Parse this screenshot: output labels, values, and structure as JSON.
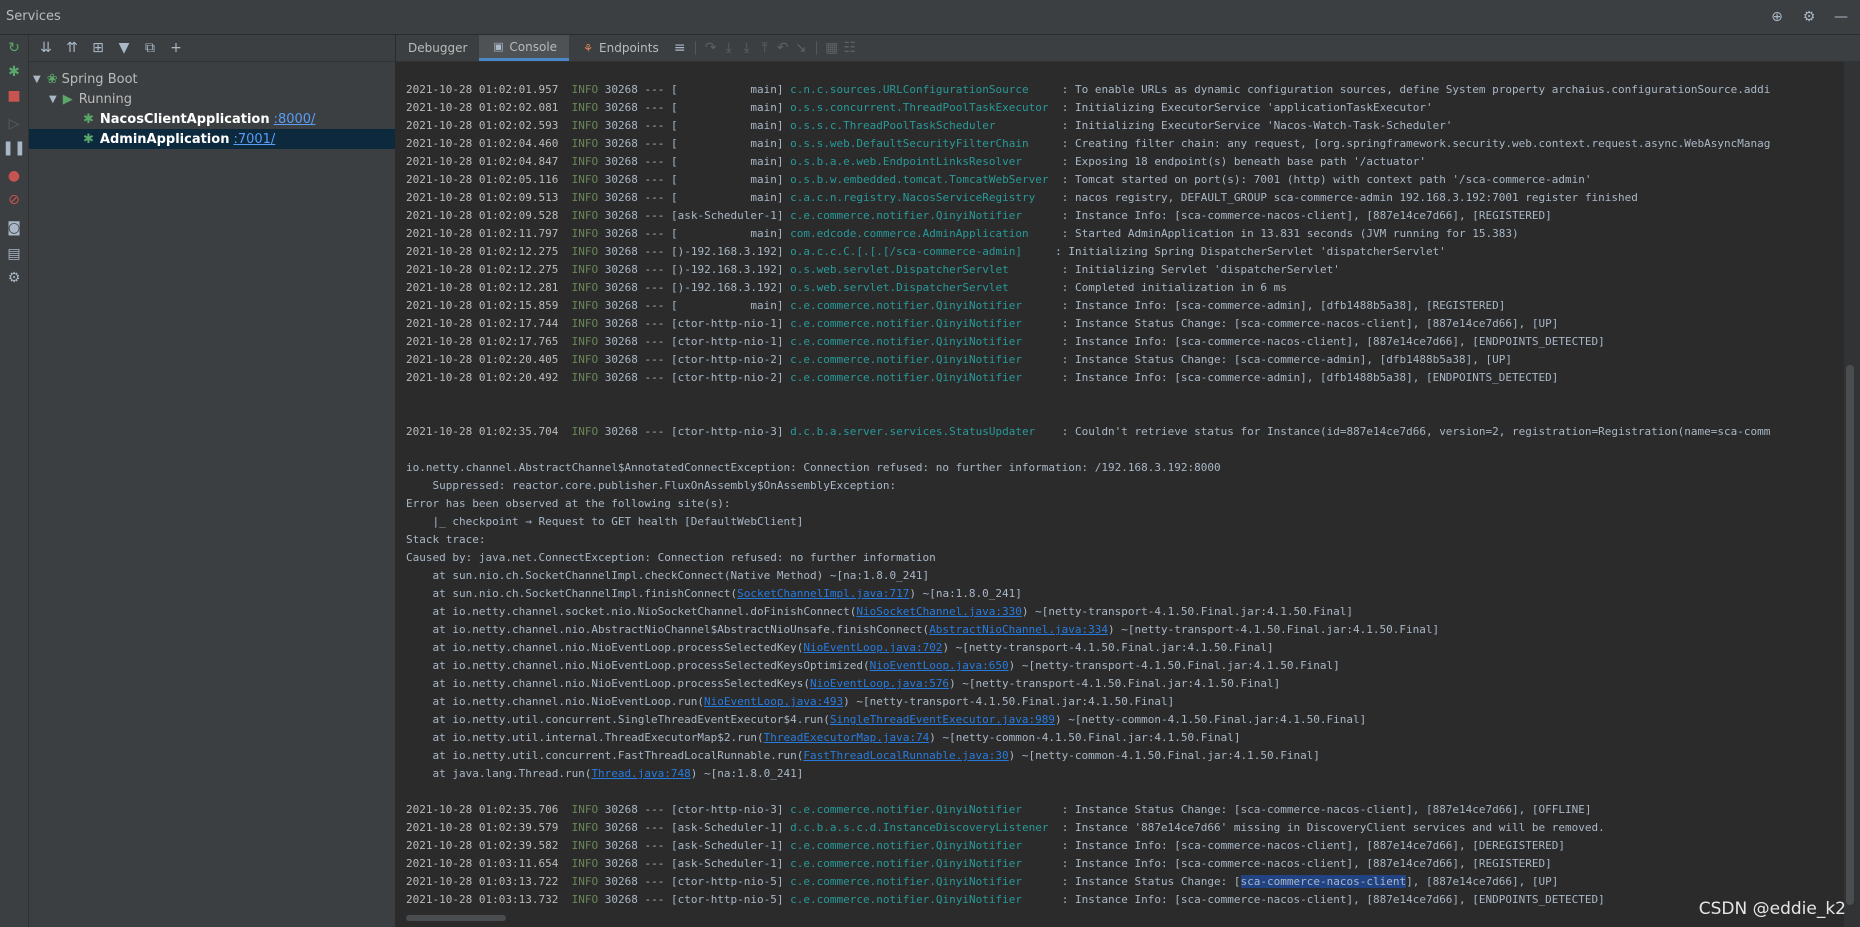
{
  "window": {
    "title": "Services"
  },
  "tree": {
    "root_label": "Spring Boot",
    "running_label": "Running",
    "apps": [
      {
        "name": "NacosClientApplication",
        "port": ":8000/"
      },
      {
        "name": "AdminApplication",
        "port": ":7001/"
      }
    ]
  },
  "tabs": {
    "debugger": "Debugger",
    "console": "Console",
    "endpoints": "Endpoints"
  },
  "watermark": "CSDN @eddie_k2",
  "log_lines": [
    {
      "ts": "",
      "lvl": "",
      "pid": "",
      "thread": "",
      "logger": "",
      "msg": ""
    },
    {
      "ts": "2021-10-28 01:02:01.957",
      "lvl": "INFO",
      "pid": "30268",
      "thread": "[           main]",
      "logger": "c.n.c.sources.URLConfigurationSource    ",
      "msg": ": To enable URLs as dynamic configuration sources, define System property archaius.configurationSource.addi"
    },
    {
      "ts": "2021-10-28 01:02:02.081",
      "lvl": "INFO",
      "pid": "30268",
      "thread": "[           main]",
      "logger": "o.s.s.concurrent.ThreadPoolTaskExecutor ",
      "msg": ": Initializing ExecutorService 'applicationTaskExecutor'"
    },
    {
      "ts": "2021-10-28 01:02:02.593",
      "lvl": "INFO",
      "pid": "30268",
      "thread": "[           main]",
      "logger": "o.s.s.c.ThreadPoolTaskScheduler         ",
      "msg": ": Initializing ExecutorService 'Nacos-Watch-Task-Scheduler'"
    },
    {
      "ts": "2021-10-28 01:02:04.460",
      "lvl": "INFO",
      "pid": "30268",
      "thread": "[           main]",
      "logger": "o.s.s.web.DefaultSecurityFilterChain    ",
      "msg": ": Creating filter chain: any request, [org.springframework.security.web.context.request.async.WebAsyncManag"
    },
    {
      "ts": "2021-10-28 01:02:04.847",
      "lvl": "INFO",
      "pid": "30268",
      "thread": "[           main]",
      "logger": "o.s.b.a.e.web.EndpointLinksResolver     ",
      "msg": ": Exposing 18 endpoint(s) beneath base path '/actuator'"
    },
    {
      "ts": "2021-10-28 01:02:05.116",
      "lvl": "INFO",
      "pid": "30268",
      "thread": "[           main]",
      "logger": "o.s.b.w.embedded.tomcat.TomcatWebServer ",
      "msg": ": Tomcat started on port(s): 7001 (http) with context path '/sca-commerce-admin'"
    },
    {
      "ts": "2021-10-28 01:02:09.513",
      "lvl": "INFO",
      "pid": "30268",
      "thread": "[           main]",
      "logger": "c.a.c.n.registry.NacosServiceRegistry   ",
      "msg": ": nacos registry, DEFAULT_GROUP sca-commerce-admin 192.168.3.192:7001 register finished"
    },
    {
      "ts": "2021-10-28 01:02:09.528",
      "lvl": "INFO",
      "pid": "30268",
      "thread": "[ask-Scheduler-1]",
      "logger": "c.e.commerce.notifier.QinyiNotifier     ",
      "msg": ": Instance Info: [sca-commerce-nacos-client], [887e14ce7d66], [REGISTERED]"
    },
    {
      "ts": "2021-10-28 01:02:11.797",
      "lvl": "INFO",
      "pid": "30268",
      "thread": "[           main]",
      "logger": "com.edcode.commerce.AdminApplication    ",
      "msg": ": Started AdminApplication in 13.831 seconds (JVM running for 15.383)"
    },
    {
      "ts": "2021-10-28 01:02:12.275",
      "lvl": "INFO",
      "pid": "30268",
      "thread": "[)-192.168.3.192]",
      "logger": "o.a.c.c.C.[.[.[/sca-commerce-admin]    ",
      "msg": ": Initializing Spring DispatcherServlet 'dispatcherServlet'"
    },
    {
      "ts": "2021-10-28 01:02:12.275",
      "lvl": "INFO",
      "pid": "30268",
      "thread": "[)-192.168.3.192]",
      "logger": "o.s.web.servlet.DispatcherServlet       ",
      "msg": ": Initializing Servlet 'dispatcherServlet'"
    },
    {
      "ts": "2021-10-28 01:02:12.281",
      "lvl": "INFO",
      "pid": "30268",
      "thread": "[)-192.168.3.192]",
      "logger": "o.s.web.servlet.DispatcherServlet       ",
      "msg": ": Completed initialization in 6 ms"
    },
    {
      "ts": "2021-10-28 01:02:15.859",
      "lvl": "INFO",
      "pid": "30268",
      "thread": "[           main]",
      "logger": "c.e.commerce.notifier.QinyiNotifier     ",
      "msg": ": Instance Info: [sca-commerce-admin], [dfb1488b5a38], [REGISTERED]"
    },
    {
      "ts": "2021-10-28 01:02:17.744",
      "lvl": "INFO",
      "pid": "30268",
      "thread": "[ctor-http-nio-1]",
      "logger": "c.e.commerce.notifier.QinyiNotifier     ",
      "msg": ": Instance Status Change: [sca-commerce-nacos-client], [887e14ce7d66], [UP]"
    },
    {
      "ts": "2021-10-28 01:02:17.765",
      "lvl": "INFO",
      "pid": "30268",
      "thread": "[ctor-http-nio-1]",
      "logger": "c.e.commerce.notifier.QinyiNotifier     ",
      "msg": ": Instance Info: [sca-commerce-nacos-client], [887e14ce7d66], [ENDPOINTS_DETECTED]"
    },
    {
      "ts": "2021-10-28 01:02:20.405",
      "lvl": "INFO",
      "pid": "30268",
      "thread": "[ctor-http-nio-2]",
      "logger": "c.e.commerce.notifier.QinyiNotifier     ",
      "msg": ": Instance Status Change: [sca-commerce-admin], [dfb1488b5a38], [UP]"
    },
    {
      "ts": "2021-10-28 01:02:20.492",
      "lvl": "INFO",
      "pid": "30268",
      "thread": "[ctor-http-nio-2]",
      "logger": "c.e.commerce.notifier.QinyiNotifier     ",
      "msg": ": Instance Info: [sca-commerce-admin], [dfb1488b5a38], [ENDPOINTS_DETECTED]"
    }
  ],
  "error_line": {
    "ts": "2021-10-28 01:02:35.704",
    "lvl": "INFO",
    "pid": "30268",
    "thread": "[ctor-http-nio-3]",
    "logger": "d.c.b.a.server.services.StatusUpdater   ",
    "msg": ": Couldn't retrieve status for Instance(id=887e14ce7d66, version=2, registration=Registration(name=sca-comm"
  },
  "trace_text": [
    "io.netty.channel.AbstractChannel$AnnotatedConnectException: Connection refused: no further information: /192.168.3.192:8000",
    "    Suppressed: reactor.core.publisher.FluxOnAssembly$OnAssemblyException:",
    "Error has been observed at the following site(s):",
    "    |_ checkpoint → Request to GET health [DefaultWebClient]",
    "Stack trace:",
    "Caused by: java.net.ConnectException: Connection refused: no further information"
  ],
  "frames": [
    {
      "pre": "    at sun.nio.ch.SocketChannelImpl.checkConnect(Native Method) ~[na:1.8.0_241]",
      "link": "",
      "post": ""
    },
    {
      "pre": "    at sun.nio.ch.SocketChannelImpl.finishConnect(",
      "link": "SocketChannelImpl.java:717",
      "post": ") ~[na:1.8.0_241]"
    },
    {
      "pre": "    at io.netty.channel.socket.nio.NioSocketChannel.doFinishConnect(",
      "link": "NioSocketChannel.java:330",
      "post": ") ~[netty-transport-4.1.50.Final.jar:4.1.50.Final]"
    },
    {
      "pre": "    at io.netty.channel.nio.AbstractNioChannel$AbstractNioUnsafe.finishConnect(",
      "link": "AbstractNioChannel.java:334",
      "post": ") ~[netty-transport-4.1.50.Final.jar:4.1.50.Final]"
    },
    {
      "pre": "    at io.netty.channel.nio.NioEventLoop.processSelectedKey(",
      "link": "NioEventLoop.java:702",
      "post": ") ~[netty-transport-4.1.50.Final.jar:4.1.50.Final]"
    },
    {
      "pre": "    at io.netty.channel.nio.NioEventLoop.processSelectedKeysOptimized(",
      "link": "NioEventLoop.java:650",
      "post": ") ~[netty-transport-4.1.50.Final.jar:4.1.50.Final]"
    },
    {
      "pre": "    at io.netty.channel.nio.NioEventLoop.processSelectedKeys(",
      "link": "NioEventLoop.java:576",
      "post": ") ~[netty-transport-4.1.50.Final.jar:4.1.50.Final]"
    },
    {
      "pre": "    at io.netty.channel.nio.NioEventLoop.run(",
      "link": "NioEventLoop.java:493",
      "post": ") ~[netty-transport-4.1.50.Final.jar:4.1.50.Final]"
    },
    {
      "pre": "    at io.netty.util.concurrent.SingleThreadEventExecutor$4.run(",
      "link": "SingleThreadEventExecutor.java:989",
      "post": ") ~[netty-common-4.1.50.Final.jar:4.1.50.Final]"
    },
    {
      "pre": "    at io.netty.util.internal.ThreadExecutorMap$2.run(",
      "link": "ThreadExecutorMap.java:74",
      "post": ") ~[netty-common-4.1.50.Final.jar:4.1.50.Final]"
    },
    {
      "pre": "    at io.netty.util.concurrent.FastThreadLocalRunnable.run(",
      "link": "FastThreadLocalRunnable.java:30",
      "post": ") ~[netty-common-4.1.50.Final.jar:4.1.50.Final]"
    },
    {
      "pre": "    at java.lang.Thread.run(",
      "link": "Thread.java:748",
      "post": ") ~[na:1.8.0_241]"
    }
  ],
  "tail_lines": [
    {
      "ts": "2021-10-28 01:02:35.706",
      "lvl": "INFO",
      "pid": "30268",
      "thread": "[ctor-http-nio-3]",
      "logger": "c.e.commerce.notifier.QinyiNotifier     ",
      "msg": ": Instance Status Change: [sca-commerce-nacos-client], [887e14ce7d66], [OFFLINE]"
    },
    {
      "ts": "2021-10-28 01:02:39.579",
      "lvl": "INFO",
      "pid": "30268",
      "thread": "[ask-Scheduler-1]",
      "logger": "d.c.b.a.s.c.d.InstanceDiscoveryListener ",
      "msg": ": Instance '887e14ce7d66' missing in DiscoveryClient services and will be removed."
    },
    {
      "ts": "2021-10-28 01:02:39.582",
      "lvl": "INFO",
      "pid": "30268",
      "thread": "[ask-Scheduler-1]",
      "logger": "c.e.commerce.notifier.QinyiNotifier     ",
      "msg": ": Instance Info: [sca-commerce-nacos-client], [887e14ce7d66], [DEREGISTERED]"
    },
    {
      "ts": "2021-10-28 01:03:11.654",
      "lvl": "INFO",
      "pid": "30268",
      "thread": "[ask-Scheduler-1]",
      "logger": "c.e.commerce.notifier.QinyiNotifier     ",
      "msg": ": Instance Info: [sca-commerce-nacos-client], [887e14ce7d66], [REGISTERED]"
    },
    {
      "ts": "2021-10-28 01:03:13.722",
      "lvl": "INFO",
      "pid": "30268",
      "thread": "[ctor-http-nio-5]",
      "logger": "c.e.commerce.notifier.QinyiNotifier     ",
      "msg": ": Instance Status Change: [",
      "sel": "sca-commerce-nacos-client",
      "msg2": "], [887e14ce7d66], [UP]"
    },
    {
      "ts": "2021-10-28 01:03:13.732",
      "lvl": "INFO",
      "pid": "30268",
      "thread": "[ctor-http-nio-5]",
      "logger": "c.e.commerce.notifier.QinyiNotifier     ",
      "msg": ": Instance Info: [sca-commerce-nacos-client], [887e14ce7d66], [ENDPOINTS_DETECTED]"
    }
  ]
}
